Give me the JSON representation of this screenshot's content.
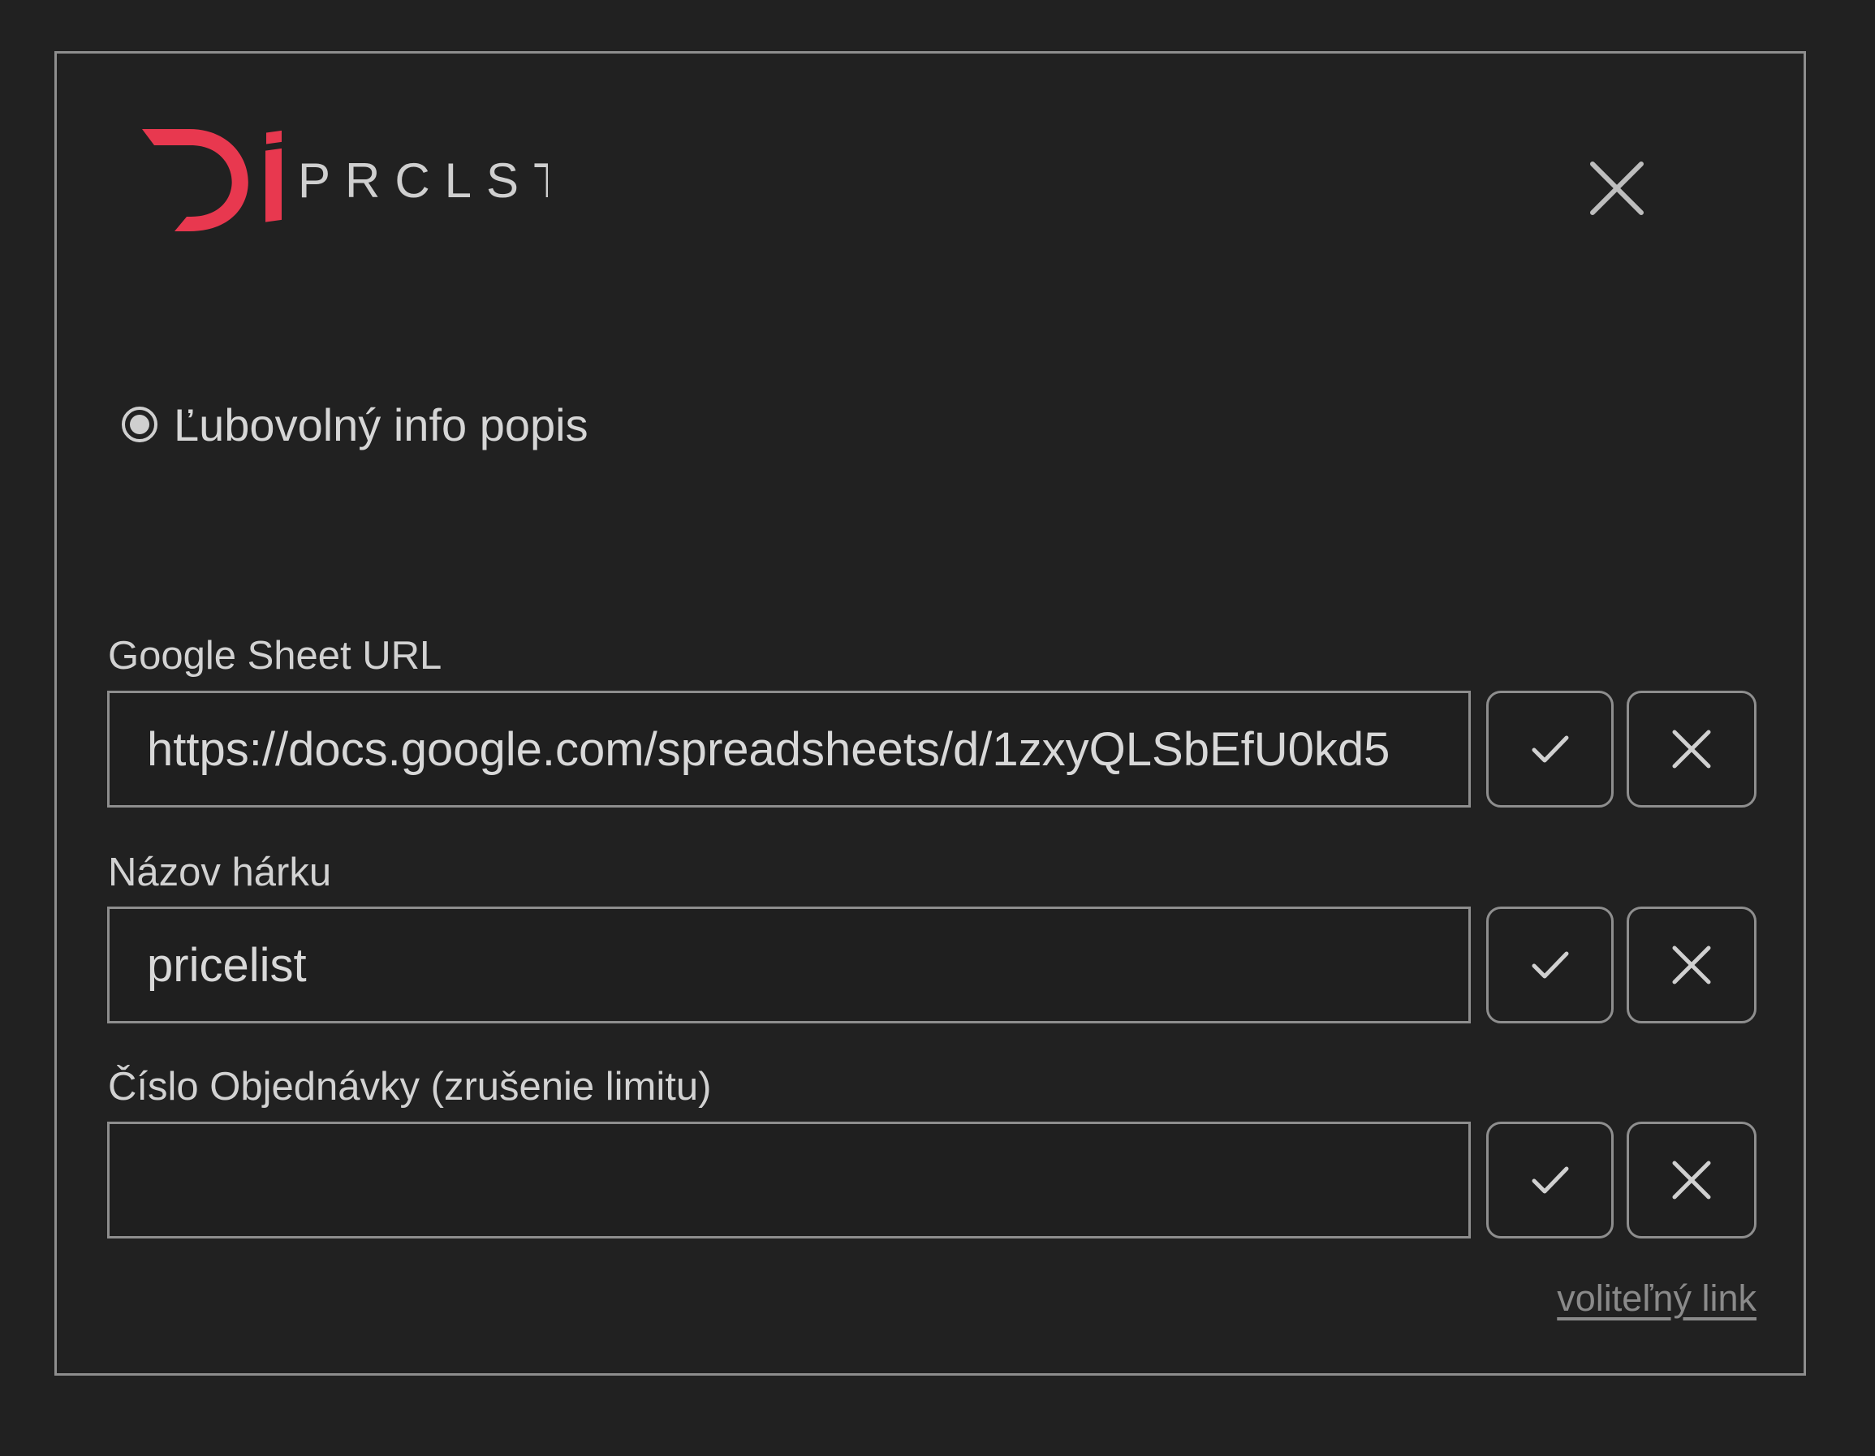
{
  "colors": {
    "background": "#212121",
    "border": "#8e8e8e",
    "brand_accent": "#e8384f",
    "text": "#d2d2d2",
    "link": "#8a8a8a"
  },
  "header": {
    "logo_text": "PRCLST",
    "close_icon": "close-icon"
  },
  "info": {
    "label": "Ľubovolný info popis",
    "icon": "radio-selected-icon"
  },
  "fields": [
    {
      "label": "Google Sheet URL",
      "value": "https://docs.google.com/spreadsheets/d/1zxyQLSbEfU0kd5",
      "placeholder": "",
      "confirm_icon": "check-icon",
      "clear_icon": "close-icon"
    },
    {
      "label": "Názov hárku",
      "value": "pricelist",
      "placeholder": "",
      "confirm_icon": "check-icon",
      "clear_icon": "close-icon"
    },
    {
      "label": "Číslo Objednávky (zrušenie limitu)",
      "value": "",
      "placeholder": "",
      "confirm_icon": "check-icon",
      "clear_icon": "close-icon"
    }
  ],
  "footer": {
    "link_label": "voliteľný link"
  }
}
